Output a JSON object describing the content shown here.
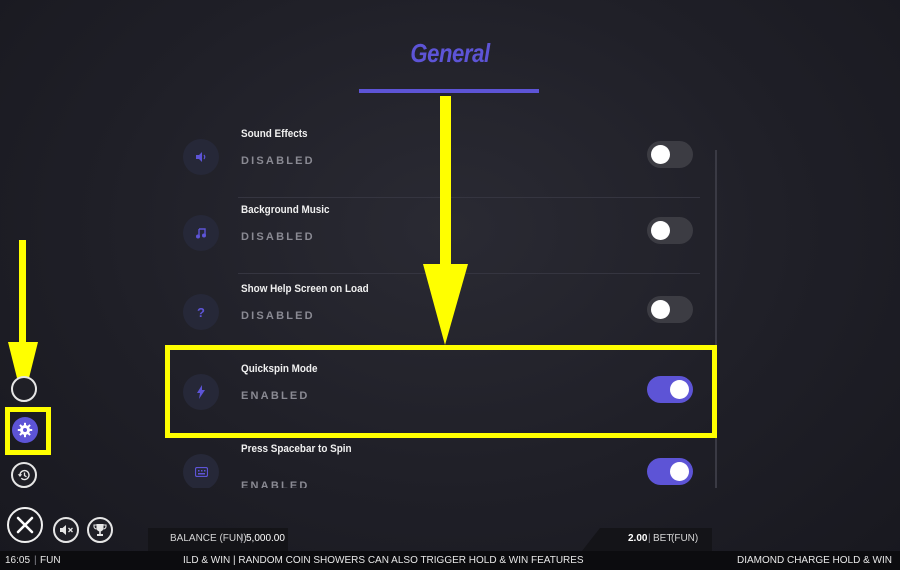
{
  "panel": {
    "title": "General"
  },
  "settings": [
    {
      "label": "Sound Effects",
      "status": "DISABLED",
      "icon": "speaker-icon",
      "enabled": false
    },
    {
      "label": "Background Music",
      "status": "DISABLED",
      "icon": "music-note-icon",
      "enabled": false
    },
    {
      "label": "Show Help Screen on Load",
      "status": "DISABLED",
      "icon": "question-icon",
      "enabled": false
    },
    {
      "label": "Quickspin Mode",
      "status": "ENABLED",
      "icon": "lightning-icon",
      "enabled": true
    },
    {
      "label": "Press Spacebar to Spin",
      "status": "ENABLED",
      "icon": "keyboard-icon",
      "enabled": true
    }
  ],
  "icons": {
    "question_glyph": "?"
  },
  "footer": {
    "balance_label": "BALANCE (FUN)",
    "balance_value": "5,000.00",
    "bet_value": "2.00",
    "bet_label": "BET",
    "bet_mode": "(FUN)",
    "time": "16:05",
    "mode": "FUN",
    "separator": "|",
    "ticker": "ILD & WIN | RANDOM COIN SHOWERS CAN ALSO TRIGGER HOLD & WIN FEATURES",
    "game_name": "DIAMOND CHARGE HOLD & WIN"
  },
  "colors": {
    "accent": "#5d54d6",
    "highlight": "#ffff00",
    "toggle_off": "#3c3c43"
  }
}
